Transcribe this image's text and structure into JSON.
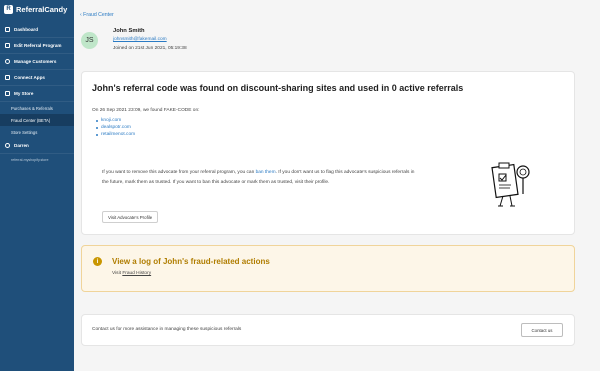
{
  "app": {
    "brand": "ReferralCandy",
    "logo_letter": "R"
  },
  "sidebar": {
    "items": [
      {
        "label": "Dashboard",
        "icon": "dashboard-icon"
      },
      {
        "label": "Edit Referral Program",
        "icon": "edit-icon"
      },
      {
        "label": "Manage Customers",
        "icon": "users-icon"
      },
      {
        "label": "Connect Apps",
        "icon": "plug-icon"
      },
      {
        "label": "My Store",
        "icon": "store-icon"
      }
    ],
    "store_subitems": [
      {
        "label": "Purchases & Referrals"
      },
      {
        "label": "Fraud Center (BETA)"
      },
      {
        "label": "Store Settings"
      }
    ],
    "user": {
      "label": "Darren",
      "icon": "user-icon"
    },
    "store_id": "referral-myshopify.store"
  },
  "header": {
    "back_label": "Fraud Center"
  },
  "profile": {
    "initials": "JS",
    "name": "John Smith",
    "email": "johnsmith@fakemail.com",
    "joined": "Joined on 21st Jun 2021, 05:19:38"
  },
  "fraud_card": {
    "title": "John's referral code was found on discount-sharing sites and used in 0 active referrals",
    "detected": "On 26 Sep 2021 23:09, we found FAKE-CODE on:",
    "sites": [
      "knoji.com",
      "dealspotr.com",
      "retailmenot.com"
    ],
    "advice_part1": "If you want to remove this advocate from your referral program, you can ",
    "advice_link": "ban them",
    "advice_part2": ". If you don't want us to flag this advocate's suspicious referrals in the future, mark them as trusted. If you want to ban this advocate or mark them as trusted, visit their profile.",
    "visit_button": "Visit Advocate's Profile"
  },
  "log_card": {
    "icon_glyph": "i",
    "title": "View a log of John's fraud-related actions",
    "visit_prefix": "Visit ",
    "visit_link": "Fraud History"
  },
  "contact_card": {
    "text": "Contact us for more assistance in managing these suspicious referrals",
    "button": "Contact us"
  },
  "colors": {
    "sidebar_bg": "#1f4f7a",
    "link": "#2b7bc4",
    "warning_bg": "#fdf6e8",
    "warning_text": "#b07d00"
  }
}
